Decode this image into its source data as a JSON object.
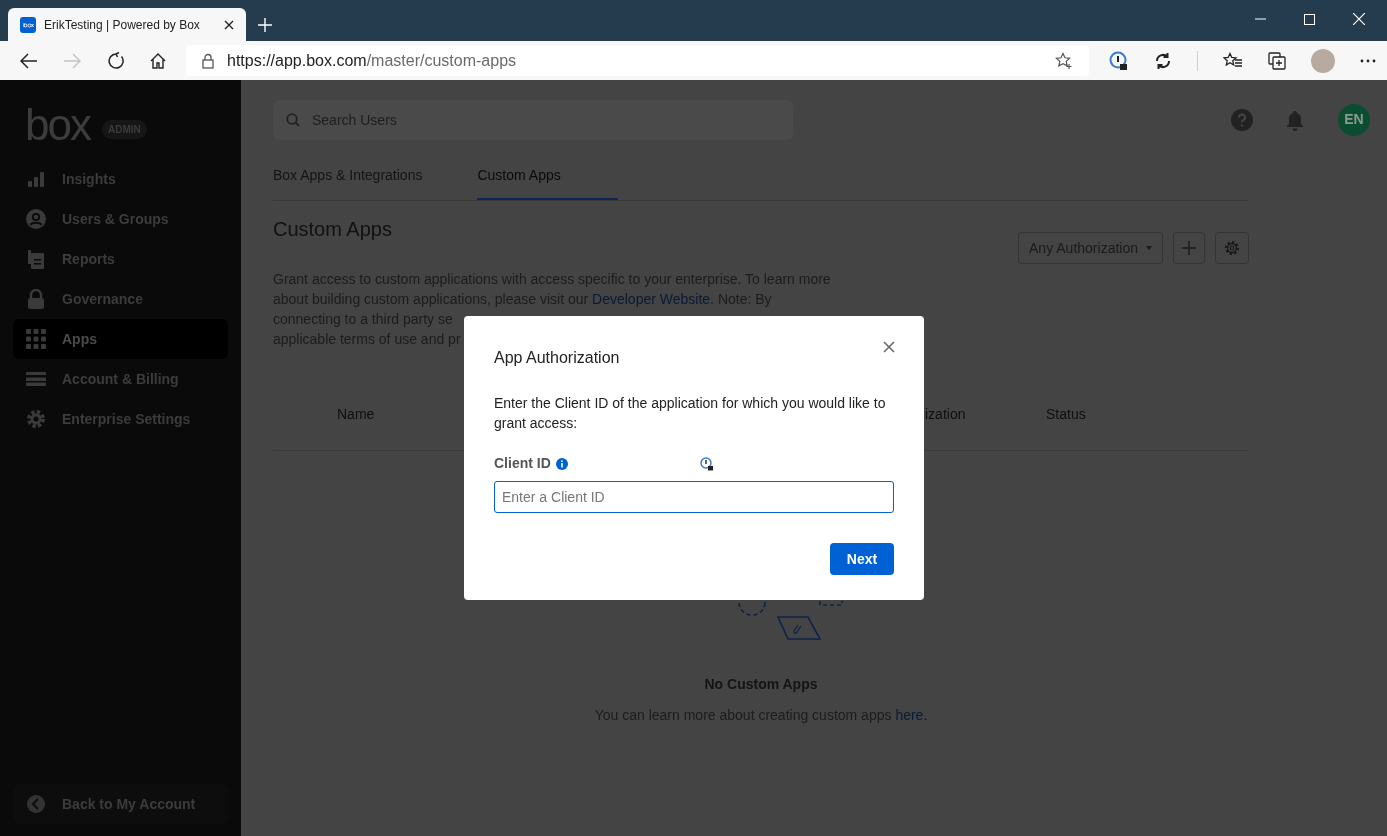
{
  "browser": {
    "tab_title": "ErikTesting | Powered by Box",
    "url_host": "https://app.box.com",
    "url_path": "/master/custom-apps"
  },
  "sidebar": {
    "logo": "box",
    "badge": "ADMIN",
    "items": [
      {
        "label": "Insights",
        "selected": false
      },
      {
        "label": "Users & Groups",
        "selected": false
      },
      {
        "label": "Reports",
        "selected": false
      },
      {
        "label": "Governance",
        "selected": false
      },
      {
        "label": "Apps",
        "selected": true
      },
      {
        "label": "Account & Billing",
        "selected": false
      },
      {
        "label": "Enterprise Settings",
        "selected": false
      }
    ],
    "footer": "Back to My Account"
  },
  "header": {
    "search_placeholder": "Search Users",
    "avatar": "EN"
  },
  "tabs": [
    {
      "label": "Box Apps & Integrations",
      "selected": false
    },
    {
      "label": "Custom Apps",
      "selected": true
    }
  ],
  "page_title": "Custom Apps",
  "filter": "Any Authorization",
  "intro": {
    "before": "Grant access to custom applications with access specific to your enterprise. To learn more\nabout building custom applications, please visit our ",
    "link": "Developer Website",
    "after": ". Note: By\nconnecting to a third party se\napplicable terms of use and pr"
  },
  "table": {
    "columns": [
      "Name",
      "ization",
      "Status"
    ]
  },
  "empty": {
    "title": "No Custom Apps",
    "text": "You can learn more about creating custom apps ",
    "link": "here",
    "after": "."
  },
  "dialog": {
    "title": "App Authorization",
    "message": "Enter the Client ID of the application for which you would like to grant access:",
    "field_label": "Client ID",
    "placeholder": "Enter a Client ID",
    "button": "Next"
  }
}
